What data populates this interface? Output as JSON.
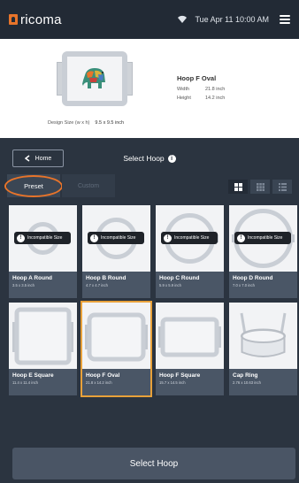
{
  "app": {
    "name": "ricoma"
  },
  "status": {
    "datetime": "Tue Apr 11  10:00 AM"
  },
  "design": {
    "size_label": "Design Size (w x h)",
    "size_value": "9.5 x 9.5 inch",
    "hoop_name": "Hoop F Oval",
    "width_label": "Width",
    "width_value": "21.8 inch",
    "height_label": "Height",
    "height_value": "14.2 inch"
  },
  "nav": {
    "home_label": "Home",
    "title": "Select Hoop"
  },
  "tabs": {
    "preset": "Preset",
    "custom": "Custom"
  },
  "badge_text": "Incompatible Size",
  "hoops": [
    {
      "name": "Hoop A Round",
      "size": "3.5 x 3.5 inch",
      "incompatible": true
    },
    {
      "name": "Hoop B Round",
      "size": "4.7 x 4.7 inch",
      "incompatible": true
    },
    {
      "name": "Hoop C Round",
      "size": "5.9 x 5.9 inch",
      "incompatible": true
    },
    {
      "name": "Hoop D Round",
      "size": "7.0 x 7.0 inch",
      "incompatible": true
    },
    {
      "name": "Hoop E Square",
      "size": "11.4 x 11.4 inch",
      "incompatible": false
    },
    {
      "name": "Hoop F Oval",
      "size": "21.8 x 14.2 inch",
      "incompatible": false,
      "selected": true
    },
    {
      "name": "Hoop F Square",
      "size": "15.7 x 14.5 inch",
      "incompatible": false
    },
    {
      "name": "Cap Ring",
      "size": "2.76 x 10.63 inch",
      "incompatible": false
    }
  ],
  "actions": {
    "select_label": "Select Hoop"
  },
  "colors": {
    "accent": "#e8742a",
    "selected_outline": "#e8a13a",
    "background": "#2b3440"
  }
}
